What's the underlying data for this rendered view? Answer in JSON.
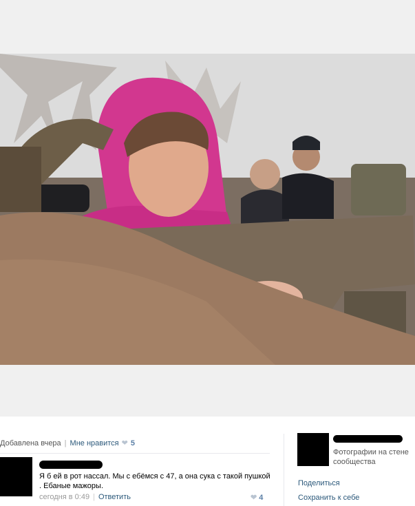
{
  "photo": {
    "icon": "photo"
  },
  "info": {
    "added": "Добавлена вчера",
    "sep": "|",
    "like_label": "Мне нравится",
    "likes": "5"
  },
  "comment": {
    "text": "Я б ей в рот нассал. Мы с ебёмся с 47, а она сука с такой пушкой . Ебаные мажоры.",
    "time": "сегодня в 0:49",
    "sep": "|",
    "reply": "Ответить",
    "likes": "4"
  },
  "sidebar": {
    "subtitle": "Фотографии на стене сообщества",
    "share": "Поделиться",
    "save": "Сохранить к себе"
  },
  "colors": {
    "link": "#2b587a",
    "likes": "#5b7fa6"
  }
}
